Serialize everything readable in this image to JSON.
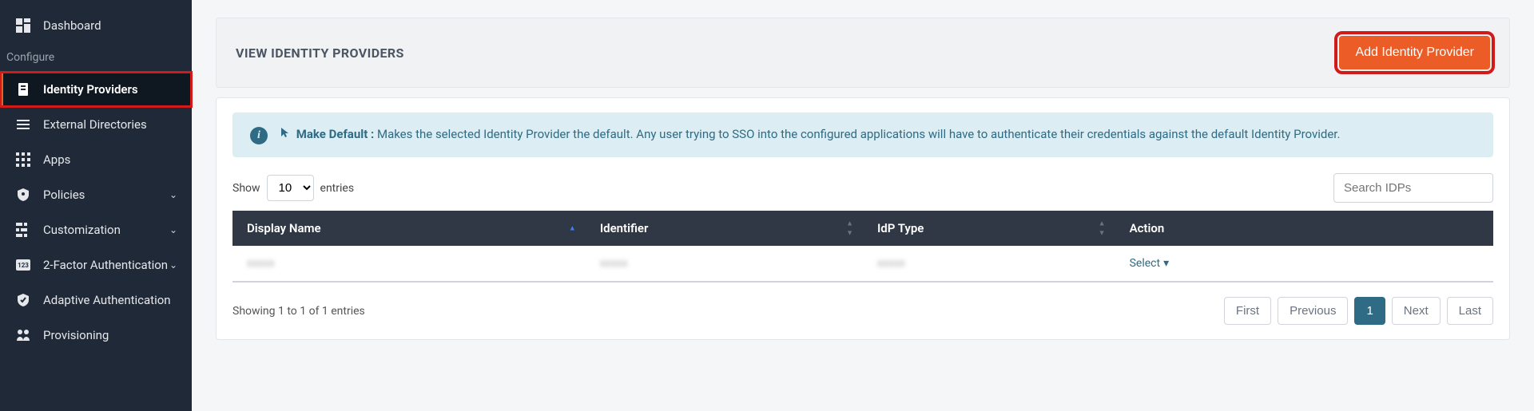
{
  "sidebar": {
    "items": [
      {
        "label": "Dashboard",
        "icon": "dashboard"
      },
      {
        "section": "Configure"
      },
      {
        "label": "Identity Providers",
        "icon": "identity",
        "active": true
      },
      {
        "label": "External Directories",
        "icon": "directories"
      },
      {
        "label": "Apps",
        "icon": "apps"
      },
      {
        "label": "Policies",
        "icon": "policies",
        "expandable": true
      },
      {
        "label": "Customization",
        "icon": "customization",
        "expandable": true
      },
      {
        "label": "2-Factor Authentication",
        "icon": "twofa",
        "expandable": true
      },
      {
        "label": "Adaptive Authentication",
        "icon": "adaptive"
      },
      {
        "label": "Provisioning",
        "icon": "provisioning"
      }
    ]
  },
  "panel": {
    "title": "VIEW IDENTITY PROVIDERS",
    "add_button": "Add Identity Provider"
  },
  "info": {
    "cursor": "▾",
    "lead": "Make Default :",
    "text": "Makes the selected Identity Provider the default. Any user trying to SSO into the configured applications will have to authenticate their credentials against the default Identity Provider."
  },
  "table": {
    "show_label_prefix": "Show",
    "show_label_suffix": "entries",
    "page_size": "10",
    "search_placeholder": "Search IDPs",
    "columns": [
      "Display Name",
      "Identifier",
      "IdP Type",
      "Action"
    ],
    "rows": [
      {
        "display_name": "xxxxx",
        "identifier": "xxxxx",
        "idp_type": "xxxxx",
        "action_label": "Select"
      }
    ],
    "footer_text": "Showing 1 to 1 of 1 entries",
    "pagination": {
      "first": "First",
      "previous": "Previous",
      "pages": [
        "1"
      ],
      "next": "Next",
      "last": "Last",
      "current": "1"
    }
  }
}
